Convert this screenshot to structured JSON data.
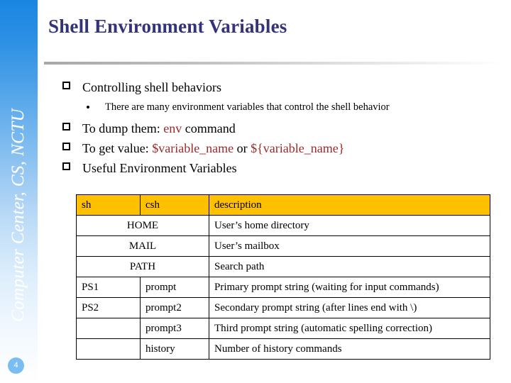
{
  "sidebar": {
    "vertical_label": "Computer Center, CS, NCTU",
    "page_number": "4"
  },
  "title": "Shell Environment Variables",
  "bullets": {
    "b1": "Controlling shell behaviors",
    "b1_sub": "There are many environment variables that control the shell behavior",
    "b2_pre": "To dump them: ",
    "b2_code": "env",
    "b2_post": " command",
    "b3_pre": "To get value: ",
    "b3_code1": "$variable_name",
    "b3_mid": " or ",
    "b3_code2": "${variable_name}",
    "b4": "Useful Environment Variables"
  },
  "table": {
    "headers": [
      "sh",
      "csh",
      "description"
    ],
    "rows": [
      {
        "merged": true,
        "name": "HOME",
        "desc": "User’s home directory"
      },
      {
        "merged": true,
        "name": "MAIL",
        "desc": "User’s mailbox"
      },
      {
        "merged": true,
        "name": "PATH",
        "desc": "Search path"
      },
      {
        "merged": false,
        "sh": "PS1",
        "csh": "prompt",
        "desc": "Primary prompt string (waiting for input commands)"
      },
      {
        "merged": false,
        "sh": "PS2",
        "csh": "prompt2",
        "desc": "Secondary prompt string (after lines end with \\)"
      },
      {
        "merged": false,
        "sh": "",
        "csh": "prompt3",
        "desc": "Third prompt string (automatic spelling correction)"
      },
      {
        "merged": false,
        "sh": "",
        "csh": "history",
        "desc": "Number of history commands"
      }
    ]
  },
  "colors": {
    "title": "#333377",
    "code_red": "#9e2a2a",
    "table_header": "#ffc000",
    "sidebar_blue": "#1a86e2",
    "page_badge": "#79bdf2"
  }
}
